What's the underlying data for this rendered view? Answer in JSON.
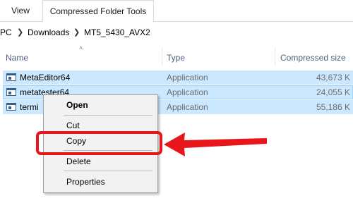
{
  "ribbon": {
    "tabs": [
      {
        "label": "View"
      },
      {
        "label": "Compressed Folder Tools"
      }
    ]
  },
  "address": {
    "crumbs": [
      "PC",
      "Downloads",
      "MT5_5430_AVX2"
    ]
  },
  "columns": {
    "name": "Name",
    "type": "Type",
    "size": "Compressed size"
  },
  "files": [
    {
      "name": "MetaEditor64",
      "type": "Application",
      "size": "43,673 K"
    },
    {
      "name": "metatester64",
      "type": "Application",
      "size": "24,055 K"
    },
    {
      "name": "termi",
      "type": "Application",
      "size": "55,186 K"
    }
  ],
  "context_menu": {
    "open": "Open",
    "cut": "Cut",
    "copy": "Copy",
    "delete": "Delete",
    "properties": "Properties"
  },
  "annotation": {
    "color": "#e8161b"
  }
}
